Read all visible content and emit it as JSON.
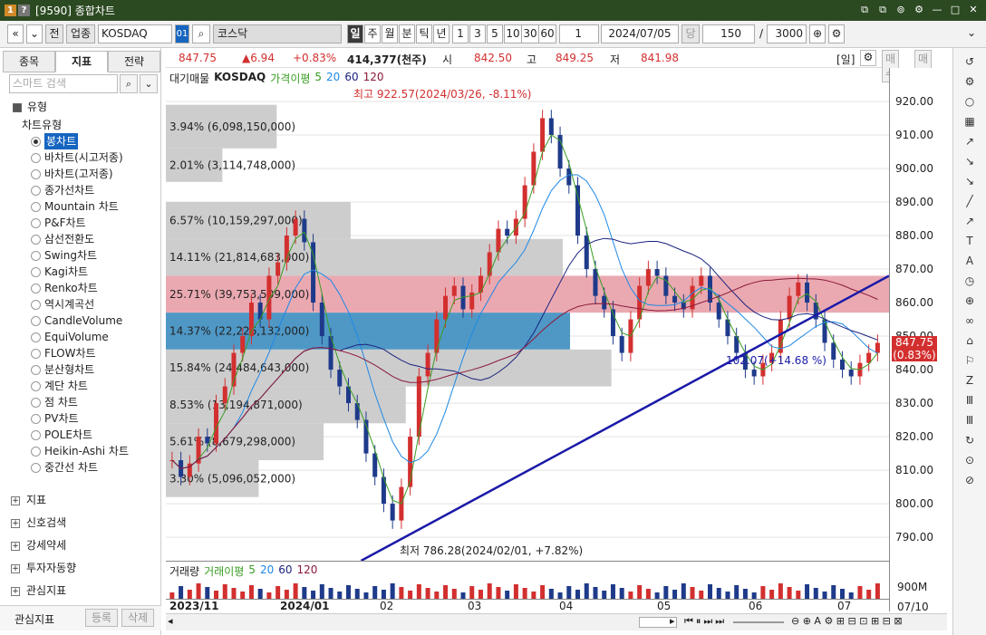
{
  "window": {
    "badges": [
      "1",
      "?"
    ],
    "title": "[9590] 종합차트",
    "controls": [
      "⧉",
      "⧉",
      "⊚",
      "⚙",
      "—",
      "□",
      "✕"
    ]
  },
  "toolbar": {
    "nav_back": "«",
    "nav_down": "⌄",
    "prev_label": "전",
    "sector_label": "업종",
    "market_value": "KOSDAQ",
    "code_badge": "01",
    "search_glyph": "⌕",
    "name_value": "코스닥",
    "periods": [
      "일",
      "주",
      "월",
      "분",
      "틱",
      "년"
    ],
    "intervals": [
      "1",
      "3",
      "5",
      "10",
      "30",
      "60"
    ],
    "count_left": "1",
    "date_value": "2024/07/05",
    "unit_label": "당",
    "bar_count": "150",
    "slash": "/",
    "total_count": "3000"
  },
  "left": {
    "tabs": [
      "종목",
      "지표",
      "전략"
    ],
    "search_placeholder": "스마트 검색",
    "group_title": "유형",
    "chart_type_label": "차트유형",
    "chart_types": [
      "봉차트",
      "바차트(시고저종)",
      "바차트(고저종)",
      "종가선차트",
      "Mountain 차트",
      "P&F차트",
      "삼선전환도",
      "Swing차트",
      "Kagi차트",
      "Renko차트",
      "역시계곡선",
      "CandleVolume",
      "EquiVolume",
      "FLOW차트",
      "분산형차트",
      "계단 차트",
      "점 차트",
      "PV차트",
      "POLE차트",
      "Heikin-Ashi 차트",
      "중간선 차트"
    ],
    "groups": [
      "지표",
      "신호검색",
      "강세약세",
      "투자자동향",
      "관심지표"
    ],
    "fav_label": "관심지표",
    "register_label": "등록",
    "delete_label": "삭제"
  },
  "pricebar": {
    "price": "847.75",
    "change": "▲6.94",
    "pct": "+0.83%",
    "volume": "414,377(천주)",
    "open_label": "시",
    "open": "842.50",
    "high_label": "고",
    "high": "849.25",
    "low_label": "저",
    "low": "841.98",
    "period_badge": "[일]",
    "buy_label": "매수",
    "sell_label": "매도"
  },
  "legend": {
    "title": "대기매물",
    "symbol": "KOSDAQ",
    "ma_label": "가격이평",
    "ma_periods": [
      "5",
      "20",
      "60",
      "120"
    ],
    "ma_colors": [
      "#3a9d23",
      "#1e88e5",
      "#1a237e",
      "#8b1a3a"
    ]
  },
  "vol_legend": {
    "title": "거래량",
    "ma_label": "거래이평",
    "ma_periods": [
      "5",
      "20",
      "60",
      "120"
    ]
  },
  "annotations": {
    "high": "최고 922.57(2024/03/26, -8.11%)",
    "low": "최저 786.28(2024/02/01, +7.82%)",
    "trend": "102.07(+14.68 %)"
  },
  "chart_data": {
    "type": "candlestick",
    "ylim": [
      783,
      930
    ],
    "y_ticks": [
      920,
      910,
      900,
      890,
      880,
      870,
      860,
      850,
      840,
      830,
      820,
      810,
      800,
      790
    ],
    "y_tick_labels": [
      "920.00",
      "910.00",
      "900.00",
      "890.00",
      "880.00",
      "870.00",
      "860.00",
      "850.00",
      "840.00",
      "830.00",
      "820.00",
      "810.00",
      "800.00",
      "790.00"
    ],
    "x_labels": [
      "2023/11",
      "2024/01",
      "02",
      "03",
      "04",
      "05",
      "06",
      "07"
    ],
    "last_price_label": "847.75",
    "last_pct_label": "(0.83%)",
    "vol_axis_label": "900M",
    "date_label": "07/10",
    "close_path": [
      813,
      808,
      812,
      820,
      818,
      830,
      835,
      845,
      850,
      860,
      855,
      868,
      872,
      880,
      885,
      878,
      860,
      850,
      840,
      835,
      830,
      825,
      815,
      808,
      800,
      795,
      805,
      820,
      838,
      845,
      855,
      862,
      865,
      858,
      863,
      868,
      875,
      882,
      880,
      885,
      895,
      905,
      915,
      910,
      900,
      895,
      880,
      870,
      862,
      858,
      850,
      845,
      855,
      865,
      870,
      868,
      862,
      860,
      858,
      865,
      868,
      860,
      855,
      850,
      845,
      840,
      838,
      842,
      845,
      855,
      862,
      866,
      860,
      855,
      848,
      843,
      840,
      838,
      842,
      845,
      848
    ],
    "volume_profile": [
      {
        "lo": 906,
        "hi": 919,
        "label": "3.94% (6,098,150,000)"
      },
      {
        "lo": 896,
        "hi": 906,
        "label": "2.01% (3,114,748,000)"
      },
      {
        "lo": 879,
        "hi": 890,
        "label": "6.57% (10,159,297,000)"
      },
      {
        "lo": 868,
        "hi": 879,
        "label": "14.11% (21,814,683,000)"
      },
      {
        "lo": 857,
        "hi": 868,
        "label": "25.71% (39,753,509,000)",
        "color": "#e8a0a8"
      },
      {
        "lo": 846,
        "hi": 857,
        "label": "14.37% (22,226,132,000)",
        "color": "#3c8dc0"
      },
      {
        "lo": 835,
        "hi": 846,
        "label": "15.84% (24,484,643,000)"
      },
      {
        "lo": 824,
        "hi": 835,
        "label": "8.53% (13,194,871,000)"
      },
      {
        "lo": 813,
        "hi": 824,
        "label": "5.61% (8,679,298,000)"
      },
      {
        "lo": 802,
        "hi": 813,
        "label": "3.30% (5,096,052,000)"
      }
    ],
    "volume_profile_max_pct": 25.71,
    "trendline": {
      "x0": 0.27,
      "y0": 783,
      "x1": 1.0,
      "y1": 868
    },
    "colors": {
      "up": "#d32f2f",
      "down": "#1e3a8a",
      "trend": "#1a1aa8",
      "profile": "#c8c8c8"
    }
  },
  "right_tools": [
    "↺",
    "⚙",
    "○",
    "▦",
    "↗",
    "↘",
    "↘",
    "╱",
    "↗",
    "T",
    "A",
    "◷",
    "⊕",
    "∞",
    "⌂",
    "⚐",
    "Z",
    "Ⅲ",
    "Ⅲ",
    "↻",
    "⊙",
    "⊘"
  ],
  "scroll": {
    "zoom_glyphs": "⊖ ⊕ A ⚙ ⊞ ⊟ ⊡ ⊞ ⊟ ⊠"
  }
}
